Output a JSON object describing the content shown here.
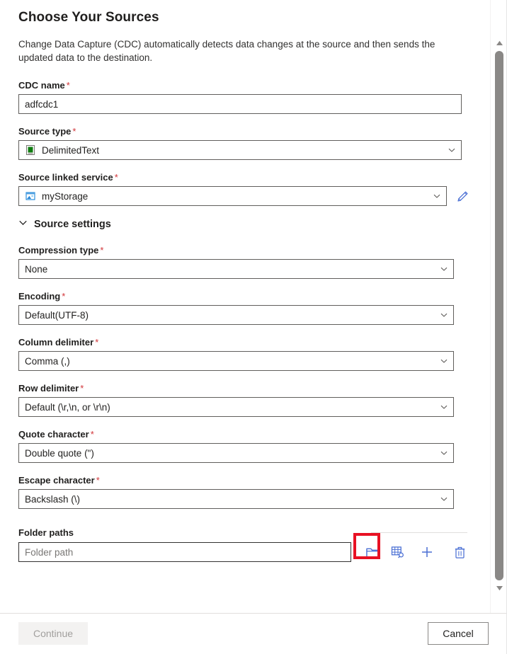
{
  "dialog": {
    "title": "Choose Your Sources",
    "description": "Change Data Capture (CDC) automatically detects data changes at the source and then sends the updated data to the destination."
  },
  "fields": {
    "cdc_name": {
      "label": "CDC name",
      "required": "*",
      "value": "adfcdc1"
    },
    "source_type": {
      "label": "Source type",
      "required": "*",
      "value": "DelimitedText",
      "icon": "delimited-text-icon"
    },
    "source_linked_service": {
      "label": "Source linked service",
      "required": "*",
      "value": "myStorage",
      "icon": "storage-account-icon",
      "edit_icon": "pencil-icon"
    }
  },
  "source_settings": {
    "label": "Source settings",
    "expanded": true,
    "chevron_icon": "chevron-down-icon",
    "items": [
      {
        "label": "Compression type",
        "required": "*",
        "value": "None"
      },
      {
        "label": "Encoding",
        "required": "*",
        "value": "Default(UTF-8)"
      },
      {
        "label": "Column delimiter",
        "required": "*",
        "value": "Comma (,)"
      },
      {
        "label": "Row delimiter",
        "required": "*",
        "value": "Default (\\r,\\n, or \\r\\n)"
      },
      {
        "label": "Quote character",
        "required": "*",
        "value": "Double quote (\")"
      },
      {
        "label": "Escape character",
        "required": "*",
        "value": "Backslash (\\)"
      }
    ]
  },
  "folder_paths": {
    "label": "Folder paths",
    "placeholder": "Folder path",
    "value": "",
    "actions": [
      {
        "name": "browse-folder-button",
        "icon": "folder-icon",
        "highlighted": true
      },
      {
        "name": "preview-data-button",
        "icon": "grid-search-icon",
        "highlighted": false
      },
      {
        "name": "add-folder-path-button",
        "icon": "plus-icon",
        "highlighted": false
      },
      {
        "name": "delete-folder-path-button",
        "icon": "trash-icon",
        "highlighted": false
      }
    ]
  },
  "footer": {
    "continue_label": "Continue",
    "continue_disabled": true,
    "cancel_label": "Cancel"
  },
  "scrollbar": {
    "up_icon": "scroll-up-arrow",
    "down_icon": "scroll-down-arrow"
  },
  "colors": {
    "accent": "#4a6fd4",
    "required": "#d13438",
    "highlight": "#e81123",
    "text": "#201f1e",
    "border": "#605e5c"
  }
}
